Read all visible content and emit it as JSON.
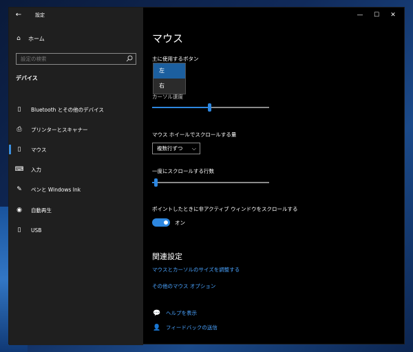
{
  "window": {
    "title": "設定",
    "back_icon": "arrow-left-icon",
    "minimize": "—",
    "maximize": "☐",
    "close": "✕"
  },
  "sidebar": {
    "home_label": "ホーム",
    "search_placeholder": "設定の検索",
    "section_title": "デバイス",
    "items": [
      {
        "label": "Bluetooth とその他のデバイス",
        "icon": "bluetooth-icon"
      },
      {
        "label": "プリンターとスキャナー",
        "icon": "printer-icon"
      },
      {
        "label": "マウス",
        "icon": "mouse-icon",
        "active": true
      },
      {
        "label": "入力",
        "icon": "keyboard-icon"
      },
      {
        "label": "ペンと Windows Ink",
        "icon": "pen-icon"
      },
      {
        "label": "自動再生",
        "icon": "autoplay-icon"
      },
      {
        "label": "USB",
        "icon": "usb-icon"
      }
    ]
  },
  "main": {
    "page_title": "マウス",
    "primary_button_label": "主に使用するボタン",
    "primary_button_options": [
      "左",
      "右"
    ],
    "primary_button_selected": "左",
    "cursor_speed_label": "カーソル速度",
    "cursor_speed_value": 0.49,
    "wheel_label": "マウス ホイールでスクロールする量",
    "wheel_value": "複数行ずつ",
    "lines_label": "一度にスクロールする行数",
    "lines_value": 0.03,
    "inactive_scroll_label": "ポイントしたときに非アクティブ ウィンドウをスクロールする",
    "inactive_scroll_state": "オン",
    "related_title": "関連設定",
    "link_cursor_size": "マウスとカーソルのサイズを調整する",
    "link_other_mouse": "その他のマウス オプション",
    "help_label": "ヘルプを表示",
    "feedback_label": "フィードバックの送信"
  },
  "colors": {
    "accent": "#2d87e0",
    "link": "#4aa3ff",
    "sidebar_bg": "#1f1f1f",
    "content_bg": "#000000"
  }
}
